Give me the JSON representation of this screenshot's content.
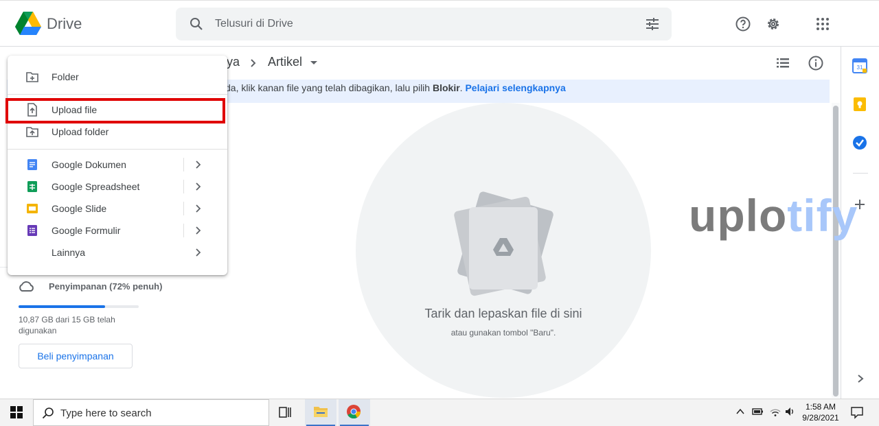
{
  "header": {
    "brand": "Drive",
    "search_placeholder": "Telusuri di Drive"
  },
  "breadcrumb": {
    "parent_partial": "ya",
    "current": "Artikel"
  },
  "banner": {
    "text": "da, klik kanan file yang telah dibagikan, lalu pilih ",
    "bold": "Blokir",
    "period": ".",
    "link": "Pelajari selengkapnya"
  },
  "menu": {
    "items": [
      {
        "label": "Folder",
        "icon": "folder-add-icon"
      },
      {
        "label": "Upload file",
        "icon": "file-upload-icon"
      },
      {
        "label": "Upload folder",
        "icon": "folder-upload-icon"
      },
      {
        "label": "Google Dokumen",
        "icon": "google-docs-icon"
      },
      {
        "label": "Google Spreadsheet",
        "icon": "google-sheets-icon"
      },
      {
        "label": "Google Slide",
        "icon": "google-slides-icon"
      },
      {
        "label": "Google Formulir",
        "icon": "google-forms-icon"
      },
      {
        "label": "Lainnya",
        "icon": ""
      }
    ]
  },
  "storage": {
    "label": "Penyimpanan (72% penuh)",
    "used_text": "10,87 GB dari 15 GB telah digunakan",
    "fraction": 0.72,
    "buy_label": "Beli penyimpanan"
  },
  "dropzone": {
    "title": "Tarik dan lepaskan file di sini",
    "subtitle": "atau gunakan tombol \"Baru\"."
  },
  "watermark": {
    "part1": "uplo",
    "part2": "tify"
  },
  "taskbar": {
    "search_text": "Type here to search",
    "time": "1:58 AM",
    "date": "9/28/2021"
  },
  "colors": {
    "accent": "#1a73e8",
    "highlight": "#e00000",
    "banner_bg": "#e8f0fe"
  }
}
